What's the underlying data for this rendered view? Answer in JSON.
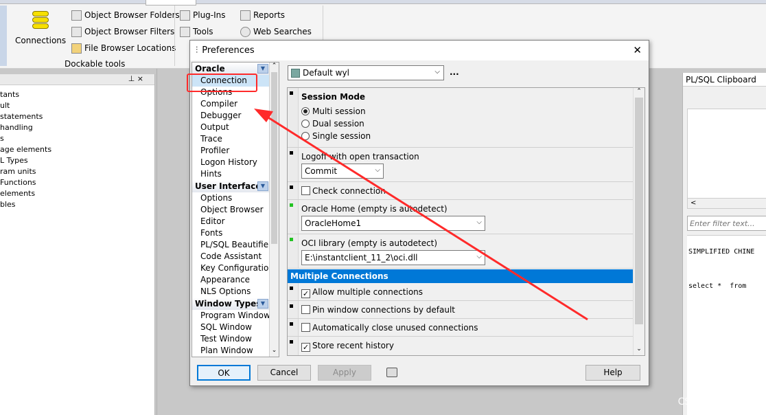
{
  "ribbon": {
    "connections_label": "Connections",
    "object_browser_folders": "Object Browser Folders",
    "object_browser_filters": "Object Browser Filters",
    "file_browser_locations": "File Browser Locations",
    "dockable_tools": "Dockable tools",
    "plugins": "Plug-Ins",
    "tools": "Tools",
    "reports": "Reports",
    "web_searches": "Web Searches"
  },
  "left_panel": {
    "pin": "⊥ ×",
    "items": [
      "tants",
      "ult",
      "statements",
      "handling",
      "s",
      "age elements",
      "L Types",
      "ram units",
      "Functions",
      "elements",
      "bles"
    ]
  },
  "right_panel": {
    "title": "PL/SQL Clipboard",
    "filter_placeholder": "Enter filter text...",
    "code1": "SIMPLIFIED CHINE",
    "code2": "select *  from"
  },
  "dialog": {
    "title": "Preferences",
    "close": "✕",
    "nav": {
      "oracle_header": "Oracle",
      "oracle_items": [
        "Connection",
        "Options",
        "Compiler",
        "Debugger",
        "Output",
        "Trace",
        "Profiler",
        "Logon History",
        "Hints"
      ],
      "ui_header": "User Interface",
      "ui_items": [
        "Options",
        "Object Browser",
        "Editor",
        "Fonts",
        "PL/SQL Beautifier",
        "Code Assistant",
        "Key Configuration",
        "Appearance",
        "NLS Options"
      ],
      "win_header": "Window Types",
      "win_items": [
        "Program Window",
        "SQL Window",
        "Test Window",
        "Plan Window"
      ]
    },
    "profile": "Default wyl",
    "more": "...",
    "session_mode": {
      "title": "Session Mode",
      "options": [
        "Multi session",
        "Dual session",
        "Single session"
      ]
    },
    "logoff": {
      "label": "Logoff with open transaction",
      "value": "Commit"
    },
    "check_connection": "Check connection",
    "oracle_home": {
      "label": "Oracle Home (empty is autodetect)",
      "value": "OracleHome1"
    },
    "oci": {
      "label": "OCI library (empty is autodetect)",
      "value": "E:\\instantclient_11_2\\oci.dll"
    },
    "multiple": {
      "title": "Multiple Connections",
      "allow": "Allow multiple connections",
      "pin": "Pin window connections by default",
      "auto_close": "Automatically close unused connections",
      "store": "Store recent history"
    },
    "buttons": {
      "ok": "OK",
      "cancel": "Cancel",
      "apply": "Apply",
      "help": "Help"
    }
  },
  "watermark": "CSDN @三思微糖",
  "colors": {
    "highlight": "#0078d7",
    "annotation": "#ff2a2a"
  }
}
